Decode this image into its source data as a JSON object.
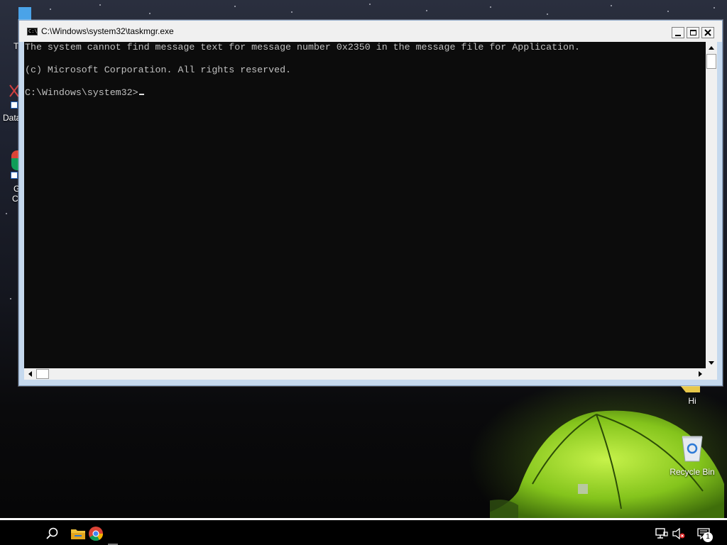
{
  "window": {
    "title": "C:\\Windows\\system32\\taskmgr.exe",
    "lines": [
      "The system cannot find message text for message number 0x2350 in the message file for Application.",
      "",
      "(c) Microsoft Corporation. All rights reserved.",
      "",
      "C:\\Windows\\system32>"
    ]
  },
  "desktop": {
    "left_labels": [
      "T",
      "Data",
      "G",
      "C"
    ],
    "right_icons": [
      {
        "label": "Hi",
        "icon": "shortcut-icon"
      },
      {
        "label": "Recycle Bin",
        "icon": "recycle-bin-icon"
      }
    ]
  },
  "taskbar": {
    "items": [
      "start-button",
      "search-icon",
      "file-explorer-icon",
      "chrome-icon"
    ],
    "tray": [
      "network-icon",
      "volume-muted-icon",
      "notification-icon"
    ],
    "notification_count": "1"
  },
  "colors": {
    "console_bg": "#0c0c0c",
    "console_text": "#c0c0c0",
    "window_frame": "#c6d9ee",
    "taskbar": "#000000"
  }
}
